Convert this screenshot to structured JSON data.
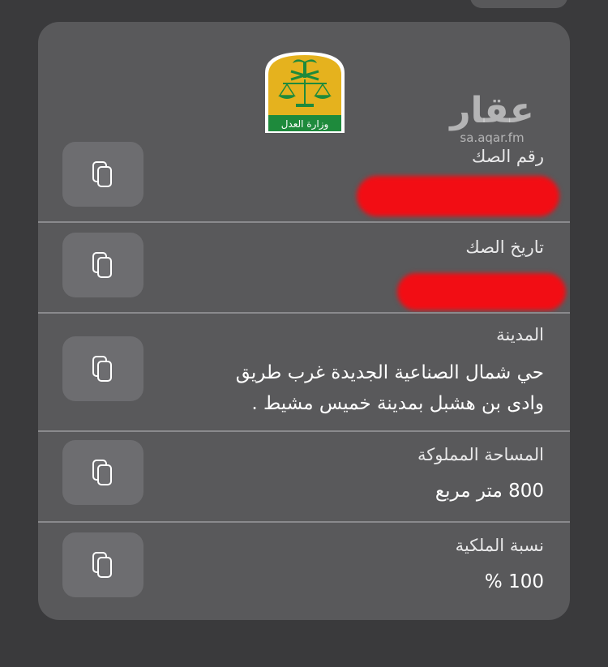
{
  "header": {
    "logo_icon": "ministry-of-justice-emblem",
    "logo_text": "وزارة العدل",
    "watermark_name": "عقار",
    "watermark_url": "sa.aqar.fm"
  },
  "fields": [
    {
      "label": "رقم الصك",
      "value": "",
      "redacted": true
    },
    {
      "label": "تاريخ الصك",
      "value": "",
      "redacted": true
    },
    {
      "label": "المدينة",
      "value_line1": "حي  شمال الصناعية الجديدة غرب طريق",
      "value_line2": "وادى بن هشبل  بمدينة خميس مشيط ."
    },
    {
      "label": "المساحة المملوكة",
      "value": "800 متر مربع"
    },
    {
      "label": "نسبة الملكية",
      "value": "100 %"
    }
  ],
  "copy_icon": "copy-icon",
  "colors": {
    "card": "#59595b",
    "background": "#3a3a3c",
    "redaction": "#f20d14",
    "logo_green": "#1e8a3c",
    "logo_gold": "#e5b21e"
  }
}
